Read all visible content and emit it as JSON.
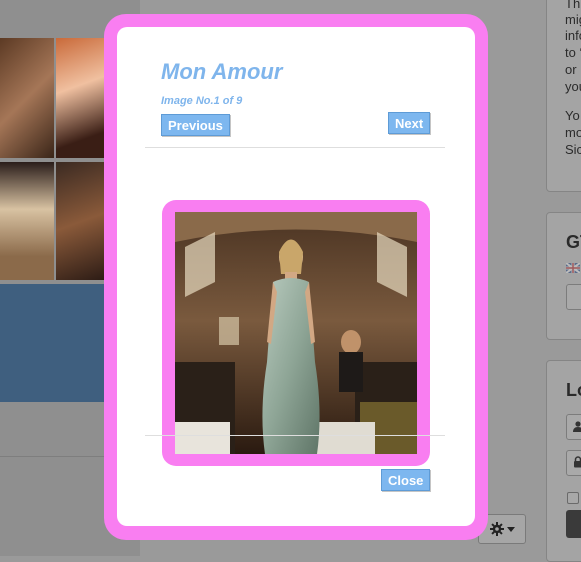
{
  "modal": {
    "title": "Mon Amour",
    "counter": "Image No.1 of 9",
    "previous_label": "Previous",
    "next_label": "Next",
    "close_label": "Close"
  },
  "sidebar": {
    "lines_top": [
      "Th",
      "mig",
      "info",
      "to ‘",
      "or",
      "you"
    ],
    "lines_mid": [
      "Yo",
      "mo",
      "Sic"
    ],
    "heading_gt": "GT",
    "heading_lo": "Lo"
  },
  "colors": {
    "frame_pink": "#f97ef1",
    "accent_blue": "#7db7ef",
    "title_blue": "#7fb5ec"
  },
  "icons": [
    "gear-icon",
    "chevron-down-icon",
    "user-icon",
    "lock-icon",
    "uk-flag-icon"
  ]
}
